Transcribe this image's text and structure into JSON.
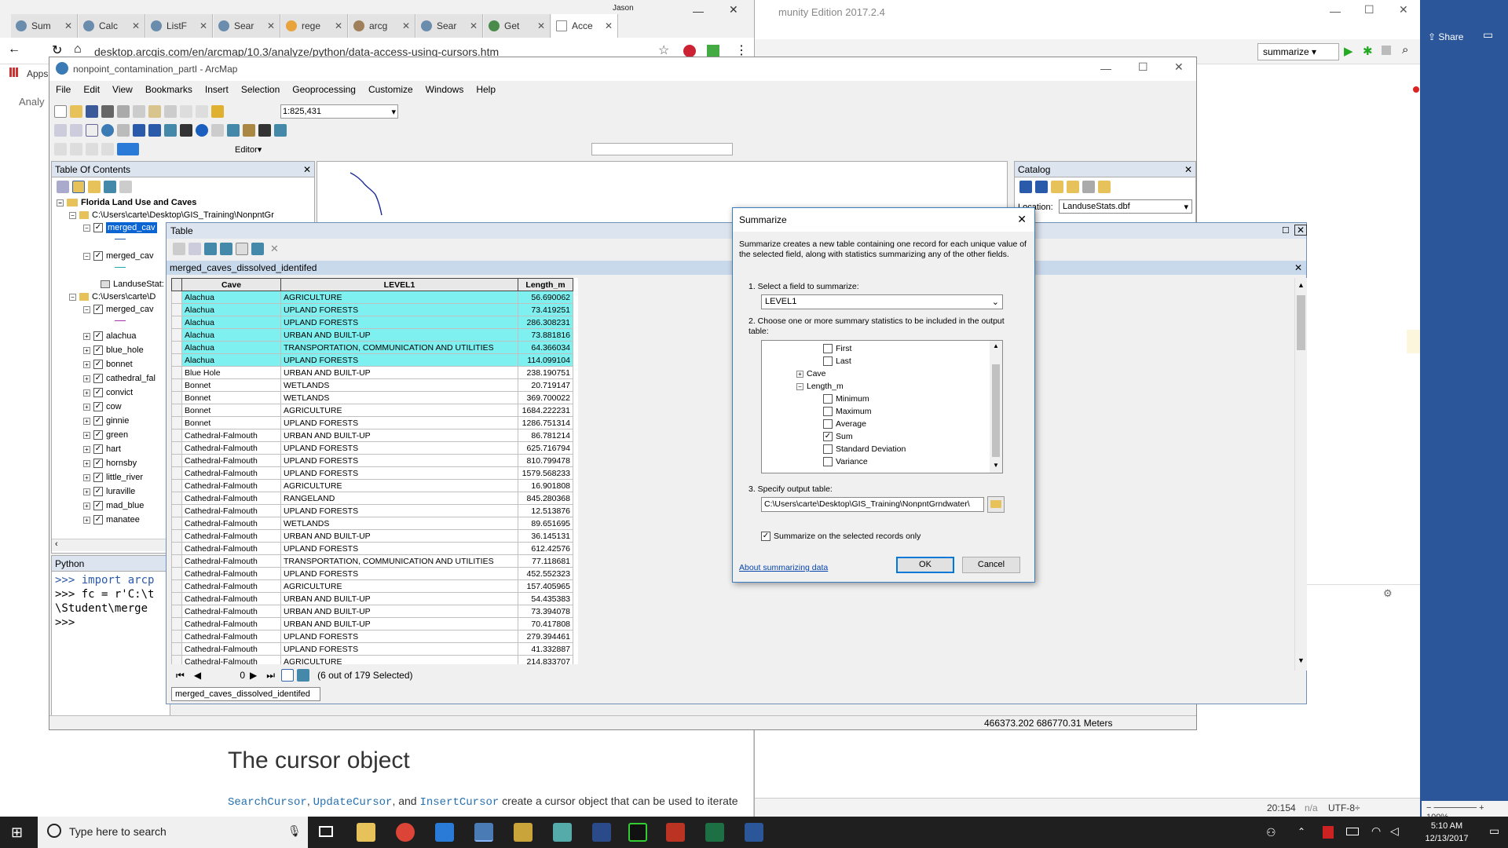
{
  "chrome": {
    "tabs": [
      "Sum",
      "Calc",
      "ListF",
      "Sear",
      "rege",
      "arcg",
      "Sear",
      "Get",
      "Acce"
    ],
    "user": "Jason",
    "url": "desktop.arcgis.com/en/arcmap/10.3/analyze/python/data-access-using-cursors.htm",
    "apps_label": "Apps",
    "side_text": "Analy",
    "heading": "The cursor object",
    "body_code1": "SearchCursor",
    "body_sep1": ", ",
    "body_code2": "UpdateCursor",
    "body_sep2": ", and ",
    "body_code3": "InsertCursor",
    "body_rest": " create a cursor object that can be used to iterate"
  },
  "pycharm": {
    "title": "munity Edition 2017.2.4",
    "run_config": "summarize",
    "share": "Share",
    "status_pos": "20:154",
    "status_na": "n/a",
    "status_enc": "UTF-8÷",
    "zoom": "100%"
  },
  "arcmap": {
    "title": "nonpoint_contamination_partI - ArcMap",
    "menu": [
      "File",
      "Edit",
      "View",
      "Bookmarks",
      "Insert",
      "Selection",
      "Geoprocessing",
      "Customize",
      "Windows",
      "Help"
    ],
    "scale": "1:825,431",
    "editor_label": "Editor▾",
    "toc_title": "Table Of Contents",
    "toc": {
      "frame": "Florida Land Use and Caves",
      "path1": "C:\\Users\\carte\\Desktop\\GIS_Training\\NonpntGr",
      "layer_selected": "merged_cav",
      "layer2": "merged_cav",
      "stats_table": "LanduseStat:",
      "path2": "C:\\Users\\carte\\D",
      "layer3": "merged_cav",
      "caves": [
        "alachua",
        "blue_hole",
        "bonnet",
        "cathedral_fal",
        "convict",
        "cow",
        "ginnie",
        "green",
        "hart",
        "hornsby",
        "little_river",
        "luraville",
        "mad_blue",
        "manatee"
      ]
    },
    "python_title": "Python",
    "python_lines": [
      ">>> import arcp",
      ">>> fc = r'C:\\t",
      " \\Student\\merge",
      ">>>"
    ],
    "catalog_title": "Catalog",
    "catalog_location_label": "Location:",
    "catalog_location": "LanduseStats.dbf",
    "coords": "466373.202  686770.31 Meters"
  },
  "table": {
    "title": "Table",
    "subtitle": "merged_caves_dissolved_identifed",
    "columns": [
      "Cave",
      "LEVEL1",
      "Length_m"
    ],
    "rows": [
      [
        "Alachua",
        "AGRICULTURE",
        "56.690062",
        true
      ],
      [
        "Alachua",
        "UPLAND FORESTS",
        "73.419251",
        true
      ],
      [
        "Alachua",
        "UPLAND FORESTS",
        "286.308231",
        true
      ],
      [
        "Alachua",
        "URBAN AND BUILT-UP",
        "73.881816",
        true
      ],
      [
        "Alachua",
        "TRANSPORTATION, COMMUNICATION AND UTILITIES",
        "64.366034",
        true
      ],
      [
        "Alachua",
        "UPLAND FORESTS",
        "114.099104",
        true
      ],
      [
        "Blue Hole",
        "URBAN AND BUILT-UP",
        "238.190751",
        false
      ],
      [
        "Bonnet",
        "WETLANDS",
        "20.719147",
        false
      ],
      [
        "Bonnet",
        "WETLANDS",
        "369.700022",
        false
      ],
      [
        "Bonnet",
        "AGRICULTURE",
        "1684.222231",
        false
      ],
      [
        "Bonnet",
        "UPLAND FORESTS",
        "1286.751314",
        false
      ],
      [
        "Cathedral-Falmouth",
        "URBAN AND BUILT-UP",
        "86.781214",
        false
      ],
      [
        "Cathedral-Falmouth",
        "UPLAND FORESTS",
        "625.716794",
        false
      ],
      [
        "Cathedral-Falmouth",
        "UPLAND FORESTS",
        "810.799478",
        false
      ],
      [
        "Cathedral-Falmouth",
        "UPLAND FORESTS",
        "1579.568233",
        false
      ],
      [
        "Cathedral-Falmouth",
        "AGRICULTURE",
        "16.901808",
        false
      ],
      [
        "Cathedral-Falmouth",
        "RANGELAND",
        "845.280368",
        false
      ],
      [
        "Cathedral-Falmouth",
        "UPLAND FORESTS",
        "12.513876",
        false
      ],
      [
        "Cathedral-Falmouth",
        "WETLANDS",
        "89.651695",
        false
      ],
      [
        "Cathedral-Falmouth",
        "URBAN AND BUILT-UP",
        "36.145131",
        false
      ],
      [
        "Cathedral-Falmouth",
        "UPLAND FORESTS",
        "612.42576",
        false
      ],
      [
        "Cathedral-Falmouth",
        "TRANSPORTATION, COMMUNICATION AND UTILITIES",
        "77.118681",
        false
      ],
      [
        "Cathedral-Falmouth",
        "UPLAND FORESTS",
        "452.552323",
        false
      ],
      [
        "Cathedral-Falmouth",
        "AGRICULTURE",
        "157.405965",
        false
      ],
      [
        "Cathedral-Falmouth",
        "URBAN AND BUILT-UP",
        "54.435383",
        false
      ],
      [
        "Cathedral-Falmouth",
        "URBAN AND BUILT-UP",
        "73.394078",
        false
      ],
      [
        "Cathedral-Falmouth",
        "URBAN AND BUILT-UP",
        "70.417808",
        false
      ],
      [
        "Cathedral-Falmouth",
        "UPLAND FORESTS",
        "279.394461",
        false
      ],
      [
        "Cathedral-Falmouth",
        "UPLAND FORESTS",
        "41.332887",
        false
      ],
      [
        "Cathedral-Falmouth",
        "AGRICULTURE",
        "214.833707",
        false
      ]
    ],
    "record_index": "0",
    "selection_status": "(6 out of 179 Selected)",
    "tab_label": "merged_caves_dissolved_identifed"
  },
  "dialog": {
    "title": "Summarize",
    "description": "Summarize creates a new table containing one record for each unique value of the selected field, along with statistics summarizing any of the other fields.",
    "step1": "1.  Select a field to summarize:",
    "field": "LEVEL1",
    "step2": "2.  Choose one or more summary statistics to be included in the output table:",
    "stats": {
      "first": "First",
      "last": "Last",
      "cave": "Cave",
      "length": "Length_m",
      "minimum": "Minimum",
      "maximum": "Maximum",
      "average": "Average",
      "sum": "Sum",
      "stddev": "Standard Deviation",
      "variance": "Variance"
    },
    "step3": "3.  Specify output table:",
    "output_path": "C:\\Users\\carte\\Desktop\\GIS_Training\\NonpntGrndwater\\",
    "selected_only": "Summarize on the selected records only",
    "about_link": "About summarizing data",
    "ok": "OK",
    "cancel": "Cancel"
  },
  "taskbar": {
    "search_placeholder": "Type here to search",
    "time": "5:10 AM",
    "date": "12/13/2017"
  }
}
